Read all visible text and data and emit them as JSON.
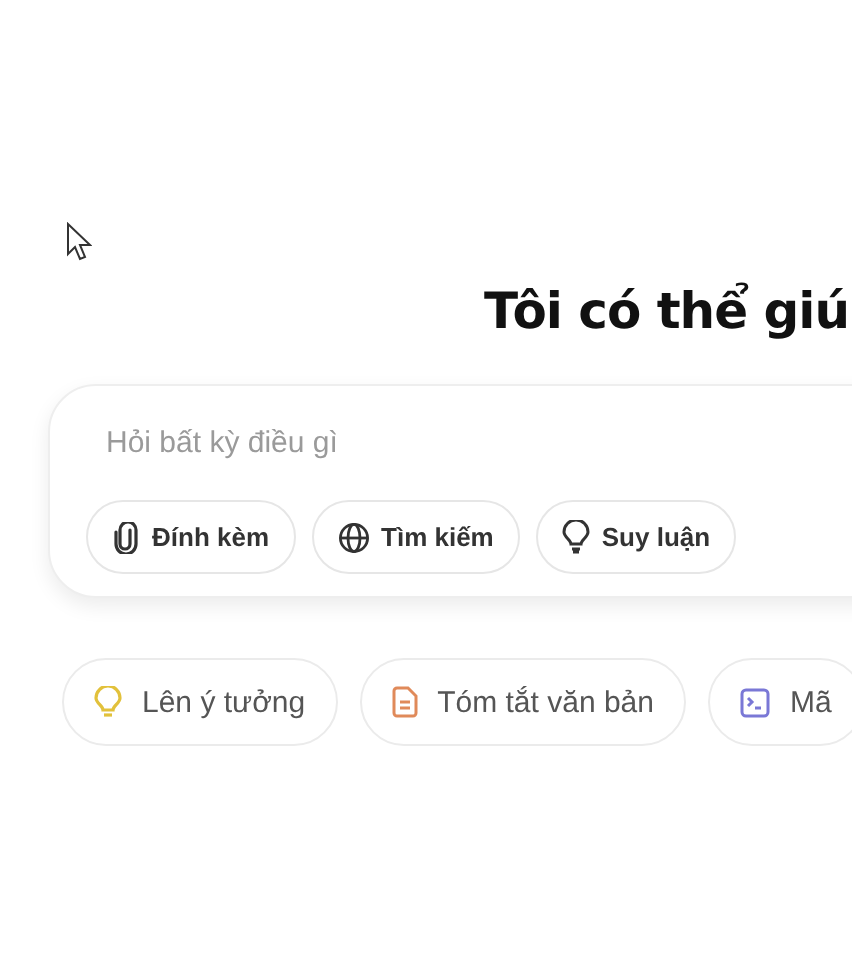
{
  "heading": "Tôi có thể giú",
  "prompt": {
    "placeholder": "Hỏi bất kỳ điều gì"
  },
  "tools": [
    {
      "kind": "attach",
      "label": "Đính kèm"
    },
    {
      "kind": "search",
      "label": "Tìm kiếm"
    },
    {
      "kind": "reason",
      "label": "Suy luận"
    }
  ],
  "suggestions": [
    {
      "kind": "idea",
      "label": "Lên ý tưởng",
      "color": "#e2c13b"
    },
    {
      "kind": "summary",
      "label": "Tóm tắt văn bản",
      "color": "#e08a5a"
    },
    {
      "kind": "code",
      "label": "Mã",
      "color": "#7a78d6"
    }
  ]
}
